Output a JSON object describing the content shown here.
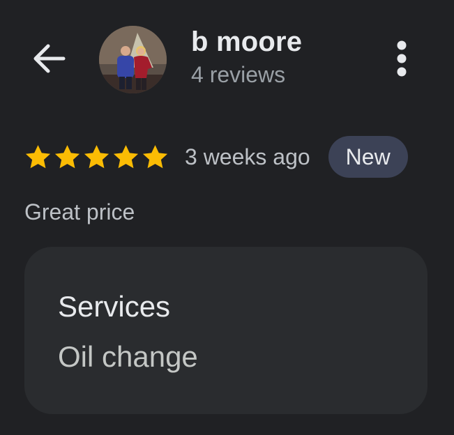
{
  "header": {
    "back_icon": "arrow-left-icon",
    "avatar_alt": "reviewer photo",
    "reviewer_name": "b moore",
    "review_count": "4 reviews",
    "more_icon": "more-vertical-icon"
  },
  "review": {
    "rating": 5,
    "max_rating": 5,
    "star_color": "#fbbc04",
    "time": "3 weeks ago",
    "badge": "New",
    "text": "Great price"
  },
  "services": {
    "title": "Services",
    "value": "Oil change"
  }
}
